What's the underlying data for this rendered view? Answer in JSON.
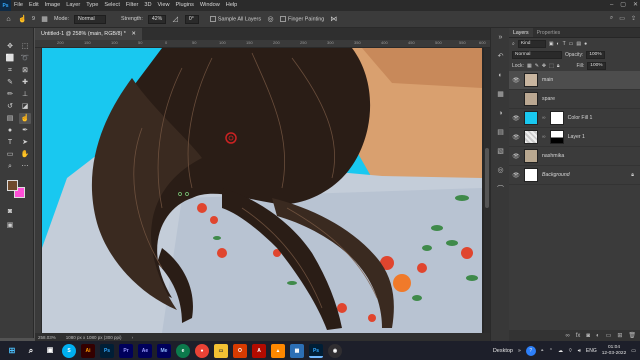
{
  "app": {
    "logo": "Ps",
    "menu": [
      "File",
      "Edit",
      "Image",
      "Layer",
      "Type",
      "Select",
      "Filter",
      "3D",
      "View",
      "Plugins",
      "Window",
      "Help"
    ],
    "window_controls": [
      "–",
      "▢",
      "✕"
    ]
  },
  "options_bar": {
    "size_value": "9",
    "mode_label": "Mode:",
    "mode_value": "Normal",
    "strength_label": "Strength:",
    "strength_value": "42%",
    "angle_value": "0°",
    "sample_all_layers": "Sample All Layers",
    "finger_painting": "Finger Painting"
  },
  "document": {
    "tab_title": "Untitled-1 @ 258% (main, RGB/8) *",
    "ruler_ticks": [
      "200",
      "150",
      "100",
      "50",
      "0",
      "50",
      "100",
      "150",
      "200",
      "250",
      "300",
      "350",
      "400",
      "450",
      "500",
      "550",
      "600"
    ],
    "status_zoom": "258.03%",
    "status_info": "1080 px x 1080 px (300 ppi)"
  },
  "tools_icons": [
    "move-icon",
    "artboard-icon",
    "marquee-icon",
    "lasso-icon",
    "crop-icon",
    "frame-icon",
    "eyedropper-icon",
    "heal-icon",
    "brush-icon",
    "stamp-icon",
    "history-brush-icon",
    "eraser-icon",
    "gradient-icon",
    "smudge-icon",
    "dodge-icon",
    "pen-icon",
    "type-icon",
    "path-select-icon",
    "rectangle-icon",
    "hand-icon",
    "zoom-icon",
    "more-icon"
  ],
  "layers_panel": {
    "tabs": [
      "Layers",
      "Properties"
    ],
    "filter_kind": "Kind",
    "blend_mode": "Normal",
    "opacity_label": "Opacity:",
    "opacity_value": "100%",
    "lock_label": "Lock:",
    "fill_label": "Fill:",
    "fill_value": "100%",
    "layers": [
      {
        "name": "main"
      },
      {
        "name": "spare"
      },
      {
        "name": "Color Fill 1"
      },
      {
        "name": "Layer 1"
      },
      {
        "name": "nashmika"
      },
      {
        "name": "Background"
      }
    ]
  },
  "taskbar": {
    "apps": [
      "Ai",
      "Ps",
      "Pr",
      "Ae",
      "Me",
      "Ps"
    ],
    "desktop_label": "Desktop",
    "language": "ENG",
    "time": "01:04",
    "date": "12-03-2022"
  },
  "colors": {
    "canvas_bg": "#19c8f0",
    "foreground": "#6e4a2c",
    "background_swatch": "#ff4fd8",
    "ui_dark": "#3b3b3b"
  }
}
